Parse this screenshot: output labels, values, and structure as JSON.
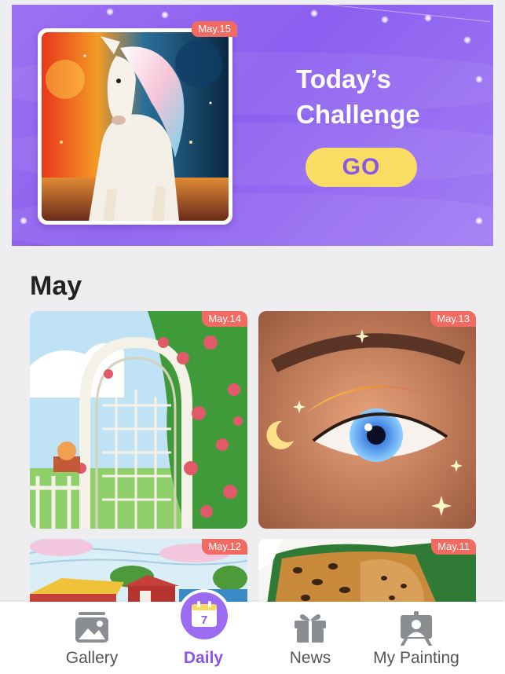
{
  "banner": {
    "featured_date": "May.15",
    "title_line1": "Today’s",
    "title_line2": "Challenge",
    "go_label": "GO"
  },
  "month": {
    "title": "May",
    "cards": [
      {
        "date": "May.14",
        "subject": "rose arch garden"
      },
      {
        "date": "May.13",
        "subject": "sparkling eye"
      },
      {
        "date": "May.12",
        "subject": "farm landscape"
      },
      {
        "date": "May.11",
        "subject": "leopard"
      }
    ]
  },
  "nav": {
    "items": [
      {
        "label": "Gallery",
        "icon": "gallery-icon"
      },
      {
        "label": "Daily",
        "icon": "calendar-icon",
        "badge": "7"
      },
      {
        "label": "News",
        "icon": "gift-icon"
      },
      {
        "label": "My Painting",
        "icon": "easel-icon"
      }
    ],
    "active": "Daily"
  },
  "colors": {
    "accent": "#8a56e8",
    "banner": "#9d71f2",
    "go_button": "#f9dc63",
    "date_badge": "#f26b63"
  }
}
